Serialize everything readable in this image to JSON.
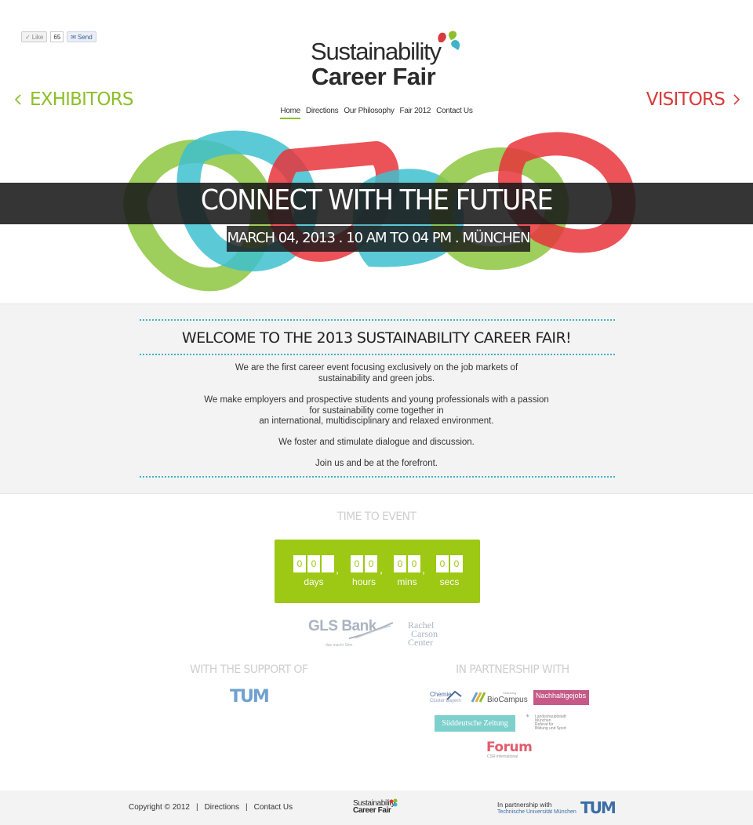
{
  "social": {
    "like_label": "Like",
    "count": "65",
    "send_label": "Send"
  },
  "logo": {
    "line1": "Sustainability",
    "line2": "Career Fair"
  },
  "side_links": {
    "left": "EXHIBITORS",
    "right": "VISITORS"
  },
  "nav": [
    {
      "label": "Home"
    },
    {
      "label": "Directions"
    },
    {
      "label": "Our Philosophy"
    },
    {
      "label": "Fair 2012"
    },
    {
      "label": "Contact Us"
    }
  ],
  "hero": {
    "title": "CONNECT WITH THE FUTURE",
    "subtitle": "MARCH 04, 2013 . 10 AM TO 04 PM . MÜNCHEN"
  },
  "welcome": {
    "heading": "WELCOME TO THE 2013 SUSTAINABILITY CAREER FAIR!",
    "p1_l1": "We are the first career event focusing exclusively on the job markets of",
    "p1_l2": "sustainability and green jobs.",
    "p2_l1": "We make employers and prospective students and young professionals with a passion",
    "p2_l2": "for sustainability come together in",
    "p2_l3": "an international, multidisciplinary and relaxed environment.",
    "p3": "We foster and stimulate dialogue and discussion.",
    "p4": "Join us and be at the forefront."
  },
  "countdown": {
    "title": "TIME TO EVENT",
    "days": [
      "0",
      "0",
      ""
    ],
    "hours": [
      "0",
      "0"
    ],
    "mins": [
      "0",
      "0"
    ],
    "secs": [
      "0",
      "0"
    ],
    "days_label": "days",
    "hours_label": "hours",
    "mins_label": "mins",
    "secs_label": "secs",
    "separator": ","
  },
  "sponsors": {
    "gls_name": "GLS Bank",
    "gls_tag": "das macht Sinn",
    "carson_l1": "Rachel",
    "carson_l2": "Carson",
    "carson_l3": "Center"
  },
  "support": {
    "title": "WITH THE SUPPORT OF",
    "tum": "TUM"
  },
  "partnership": {
    "title": "IN PARTNERSHIP WITH",
    "chemie_l1": "Chemie",
    "chemie_l2": "Cluster Bayern",
    "biocampus_small": "Straubing",
    "biocampus": "BioCampus",
    "nachhaltige": "Nachhaltigejobs",
    "sz": "Süddeutsche Zeitung",
    "lhm_l1": "Landeshauptstadt",
    "lhm_l2": "München",
    "lhm_l3": "Referat für",
    "lhm_l4": "Bildung und Sport",
    "forum": "Forum",
    "forum_sub": "CSR international"
  },
  "footer": {
    "copyright": "Copyright © 2012",
    "sep": "|",
    "directions": "Directions",
    "contact": "Contact Us",
    "logo_l1": "Sustainability",
    "logo_l2": "Career Fair",
    "partner_l1": "In partnership with",
    "partner_l2": "Technische Universität München",
    "tum": "TUM"
  },
  "colors": {
    "green": "#8dbf2a",
    "red": "#d73b3d",
    "teal": "#3fb4c6",
    "countdown_bg": "#9dc814"
  }
}
